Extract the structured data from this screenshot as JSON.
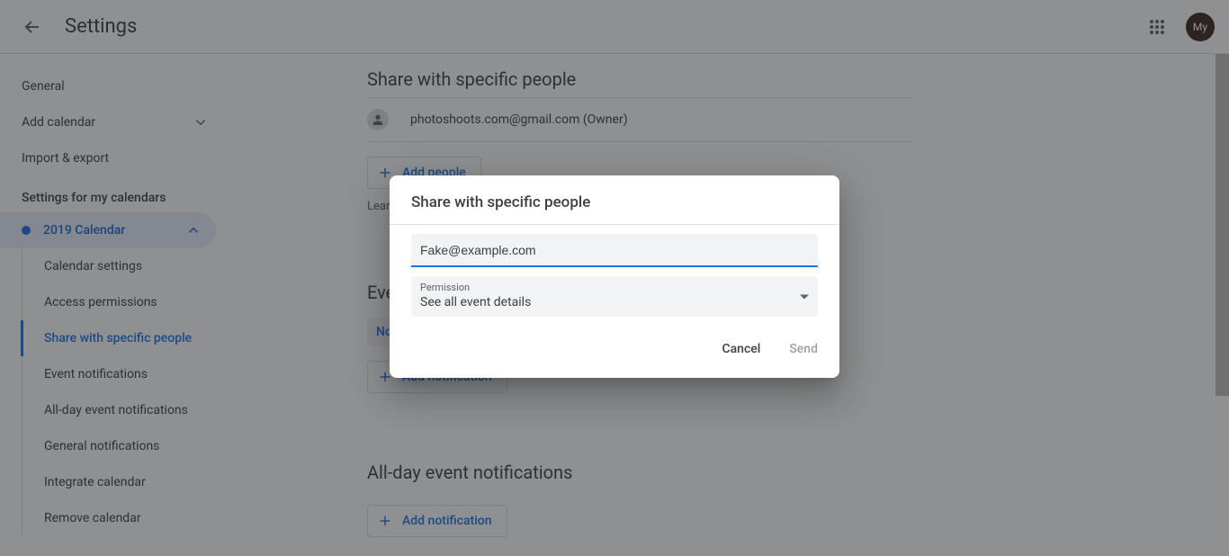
{
  "header": {
    "title": "Settings",
    "avatar_text": "My"
  },
  "sidebar": {
    "items": {
      "general": "General",
      "add_calendar": "Add calendar",
      "import_export": "Import & export"
    },
    "heading": "Settings for my calendars",
    "calendar_name": "2019 Calendar",
    "subitems": {
      "calendar_settings": "Calendar settings",
      "access_permissions": "Access permissions",
      "share_specific": "Share with specific people",
      "event_notifications": "Event notifications",
      "allday_notifications": "All-day event notifications",
      "general_notifications": "General notifications",
      "integrate": "Integrate calendar",
      "remove": "Remove calendar"
    }
  },
  "main": {
    "share_title": "Share with specific people",
    "owner_email": "photoshoots.com@gmail.com (Owner)",
    "add_people": "Add people",
    "learn_more": "Lear",
    "event_notif_title": "Eve",
    "notif_value": "No",
    "add_notification": "Add notification",
    "allday_title": "All-day event notifications"
  },
  "dialog": {
    "title": "Share with specific people",
    "email_value": "Fake@example.com",
    "perm_label": "Permission",
    "perm_value": "See all event details",
    "cancel": "Cancel",
    "send": "Send"
  }
}
